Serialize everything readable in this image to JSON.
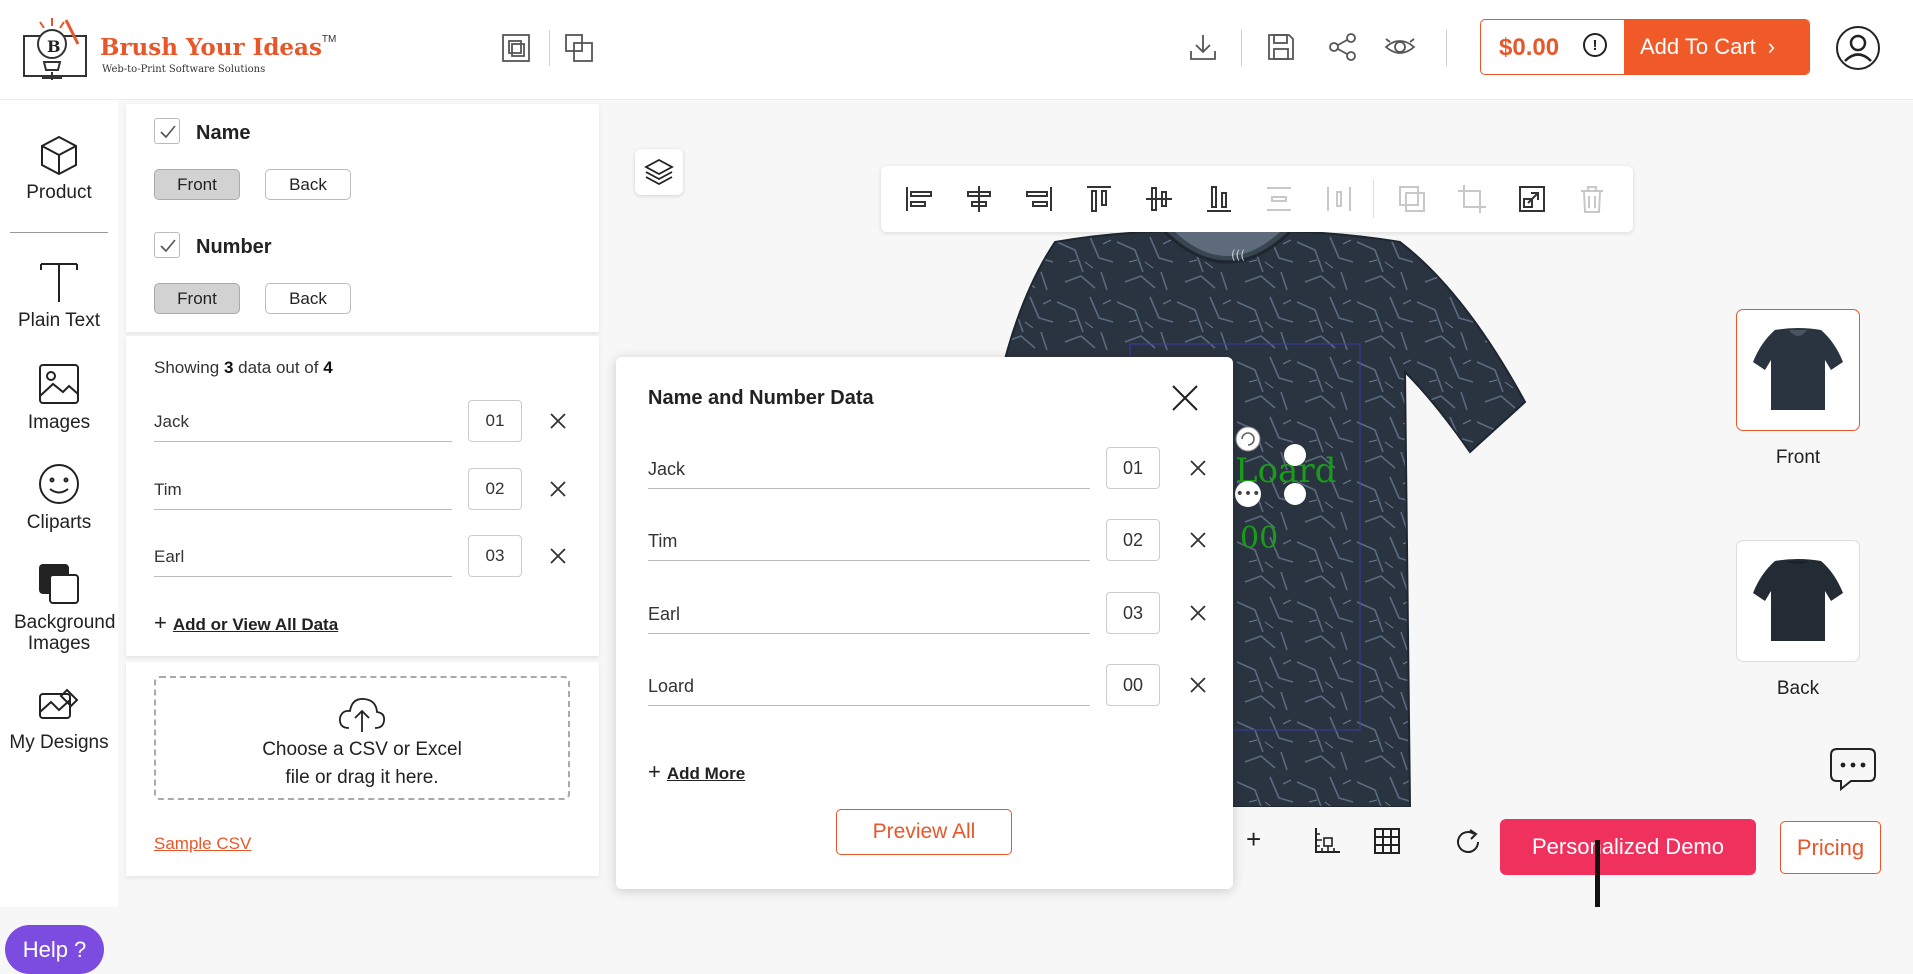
{
  "brand": {
    "name": "Brush Your Ideas",
    "trademark": "TM",
    "tagline": "Web-to-Print Software Solutions"
  },
  "header": {
    "price": "$0.00",
    "price_info": "!",
    "add_to_cart_label": "Add To Cart",
    "icons": [
      "view-front-icon",
      "view-back-icon",
      "download-icon",
      "save-icon",
      "share-icon",
      "preview-eye-icon",
      "user-avatar-icon"
    ]
  },
  "left_rail": {
    "items": [
      {
        "label": "Product",
        "icon": "cube-icon"
      },
      {
        "label": "Plain Text",
        "icon": "text-t-icon"
      },
      {
        "label": "Images",
        "icon": "image-icon"
      },
      {
        "label": "Cliparts",
        "icon": "smiley-icon"
      },
      {
        "label": "Background Images",
        "icon": "background-layers-icon"
      },
      {
        "label": "My Designs",
        "icon": "my-designs-icon"
      }
    ],
    "help_label": "Help ?"
  },
  "panel": {
    "name_section": {
      "label": "Name",
      "checked": true,
      "options": [
        "Front",
        "Back"
      ],
      "selected": "Front"
    },
    "number_section": {
      "label": "Number",
      "checked": true,
      "options": [
        "Front",
        "Back"
      ],
      "selected": "Front"
    },
    "showing": {
      "prefix": "Showing ",
      "shown": "3",
      "middle": " data out of ",
      "total": "4"
    },
    "rows": [
      {
        "name": "Jack",
        "number": "01"
      },
      {
        "name": "Tim",
        "number": "02"
      },
      {
        "name": "Earl",
        "number": "03"
      }
    ],
    "add_view_label": "Add or View All Data",
    "upload_line1": "Choose a CSV or Excel",
    "upload_line2": "file or drag it here.",
    "sample_csv": "Sample CSV"
  },
  "modal": {
    "title": "Name and Number Data",
    "rows": [
      {
        "name": "Jack",
        "number": "01"
      },
      {
        "name": "Tim",
        "number": "02"
      },
      {
        "name": "Earl",
        "number": "03"
      },
      {
        "name": "Loard",
        "number": "00"
      }
    ],
    "add_more_label": "Add More",
    "preview_all_label": "Preview All"
  },
  "canvas": {
    "preview_text_name": "Loard",
    "preview_text_number": "00",
    "colors": {
      "accent": "#f05a28",
      "demo": "#f0305d",
      "help": "#7c4ce0",
      "print_text": "#1a9c1a"
    }
  },
  "thumbnails": [
    {
      "label": "Front",
      "selected": true
    },
    {
      "label": "Back",
      "selected": false
    }
  ],
  "bottom": {
    "zoom_in": "+",
    "demo_label": "Personalized Demo",
    "pricing_label": "Pricing"
  }
}
